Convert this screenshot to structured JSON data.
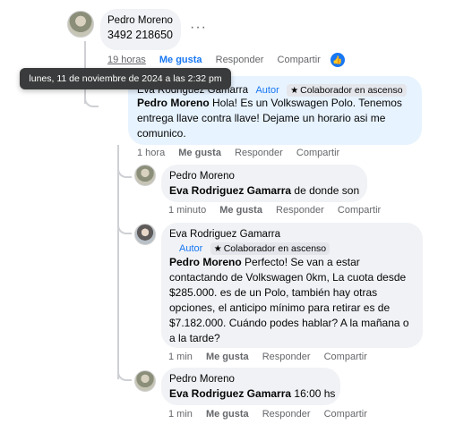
{
  "comment1": {
    "author": "Pedro Moreno",
    "text": "3492 218650",
    "time": "19 horas",
    "like": "Me gusta",
    "reply": "Responder",
    "share": "Compartir",
    "more_icon": "more-dots-icon",
    "reaction_icon": "thumbs-up-icon"
  },
  "tooltip": {
    "text": "lunes, 11 de noviembre de 2024 a las 2:32 pm"
  },
  "reply1": {
    "author": "Eva Rodriguez Gamarra",
    "autor_badge": "Autor",
    "collab_badge": "Colaborador en ascenso",
    "mention": "Pedro Moreno",
    "text": " Hola! Es un Volkswagen Polo. Tenemos entrega llave contra llave! Dejame un horario asi me comunico.",
    "time": "1 hora",
    "like": "Me gusta",
    "reply": "Responder",
    "share": "Compartir"
  },
  "reply2": {
    "author": "Pedro Moreno",
    "mention": "Eva Rodriguez Gamarra",
    "text": " de donde son",
    "time": "1 minuto",
    "like": "Me gusta",
    "reply": "Responder",
    "share": "Compartir"
  },
  "reply3": {
    "author": "Eva Rodriguez Gamarra",
    "autor_badge": "Autor",
    "collab_badge": "Colaborador en ascenso",
    "mention": "Pedro Moreno",
    "text": " Perfecto! Se van a estar contactando de Volkswagen 0km, La cuota desde $285.000. es de un Polo, también hay otras opciones, el anticipo mínimo para retirar es de $7.182.000. Cuándo podes hablar? A la mañana o a la tarde?",
    "time": "1 min",
    "like": "Me gusta",
    "reply": "Responder",
    "share": "Compartir"
  },
  "reply4": {
    "author": "Pedro Moreno",
    "mention": "Eva Rodriguez Gamarra",
    "text": " 16:00 hs",
    "time": "1 min",
    "like": "Me gusta",
    "reply": "Responder",
    "share": "Compartir"
  },
  "colors": {
    "accent": "#1877f2",
    "bubble": "#f0f2f5",
    "bubble_highlight": "#e7f3ff",
    "muted": "#65676b"
  }
}
